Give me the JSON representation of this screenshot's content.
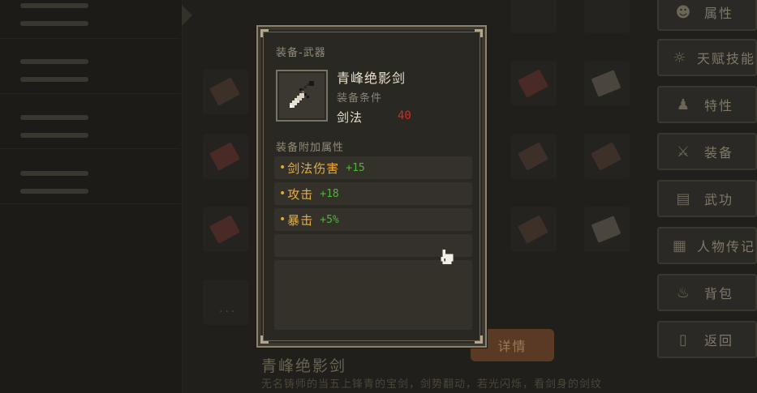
{
  "background": {
    "bag_title": "青峰绝影剑",
    "bag_desc": "无名铸师的当五上锋青的宝剑，剑势翻动，若光闪烁，看剑身的剑纹",
    "detail_button": "详情",
    "dots": "...",
    "menu": [
      {
        "label": "属性",
        "icon": "person-icon"
      },
      {
        "label": "天赋技能",
        "icon": "talent-icon"
      },
      {
        "label": "特性",
        "icon": "trait-icon"
      },
      {
        "label": "装备",
        "icon": "sword-icon"
      },
      {
        "label": "武功",
        "icon": "book-icon"
      },
      {
        "label": "人物传记",
        "icon": "scroll-icon"
      },
      {
        "label": "背包",
        "icon": "bag-icon"
      },
      {
        "label": "返回",
        "icon": "door-icon"
      }
    ]
  },
  "popup": {
    "category": "装备-武器",
    "item_name": "青峰绝影剑",
    "requirement_label": "装备条件",
    "requirement_skill": "剑法",
    "requirement_value": "40",
    "attributes_title": "装备附加属性",
    "attributes": [
      {
        "dot": "•",
        "name": "剑法伤害",
        "value": "+15"
      },
      {
        "dot": "•",
        "name": "攻击",
        "value": "+18"
      },
      {
        "dot": "•",
        "name": "暴击",
        "value": "+5%"
      }
    ]
  },
  "colors": {
    "attribute_name": "#e8ad3a",
    "attribute_value": "#4fb43a",
    "requirement_value": "#d22a22",
    "frame": "#8c836f"
  }
}
